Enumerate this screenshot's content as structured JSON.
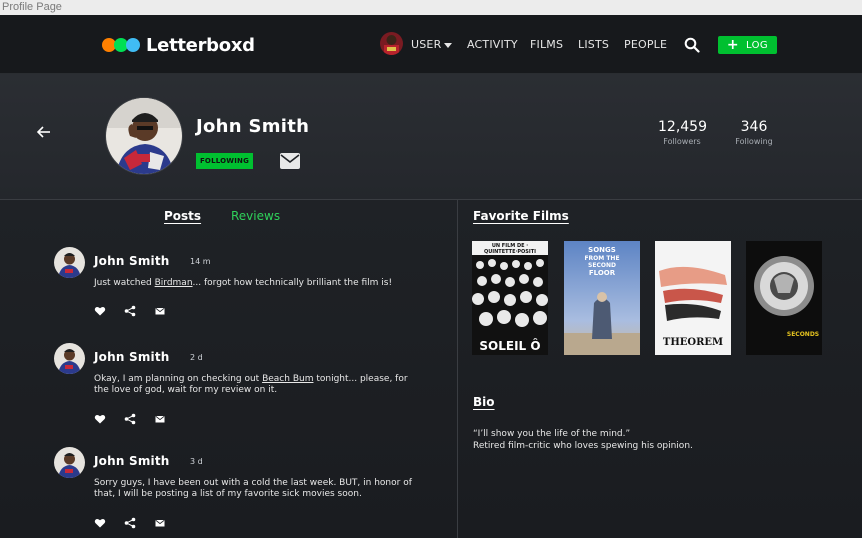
{
  "window": {
    "title": "Profile Page"
  },
  "nav": {
    "brand": "Letterboxd",
    "user_label": "USER",
    "links": [
      "ACTIVITY",
      "FILMS",
      "LISTS",
      "PEOPLE"
    ],
    "log_label": "LOG",
    "brand_colors": [
      "#ff8000",
      "#00e054",
      "#40bcf4"
    ],
    "accent": "#00c030"
  },
  "profile": {
    "name": "John Smith",
    "following_badge": "FOLLOWING",
    "followers_count": "12,459",
    "followers_label": "Followers",
    "following_count": "346",
    "following_label": "Following"
  },
  "tabs": {
    "posts": "Posts",
    "reviews": "Reviews"
  },
  "posts": [
    {
      "author": "John Smith",
      "time": "14 m",
      "before": "Just watched ",
      "link": "Birdman",
      "after": "... forgot how technically brilliant the film is!"
    },
    {
      "author": "John Smith",
      "time": "2 d",
      "before": "Okay, I am planning on checking out ",
      "link": "Beach Bum",
      "after": " tonight... please, for the love of god, wait for my review on it."
    },
    {
      "author": "John Smith",
      "time": "3 d",
      "before": "Sorry guys, I have been out with a cold the last week. BUT, in honor of that, I will be posting a list of my favorite sick movies soon.",
      "link": "",
      "after": ""
    }
  ],
  "favorites": {
    "title": "Favorite Films",
    "posters": [
      {
        "top_text": "UN FILM DE · QUINTETTE·POSITI",
        "bottom_text": "SOLEIL Ô"
      },
      {
        "top_text": "SONGS FROM THE SECOND FLOOR",
        "bottom_text": ""
      },
      {
        "top_text": "",
        "bottom_text": "THEOREM"
      },
      {
        "top_text": "",
        "bottom_text": "SECONDS"
      }
    ]
  },
  "bio": {
    "title": "Bio",
    "line1": "“I’ll show you the life of the mind.”",
    "line2": "Retired film-critic who loves spewing his opinion."
  }
}
